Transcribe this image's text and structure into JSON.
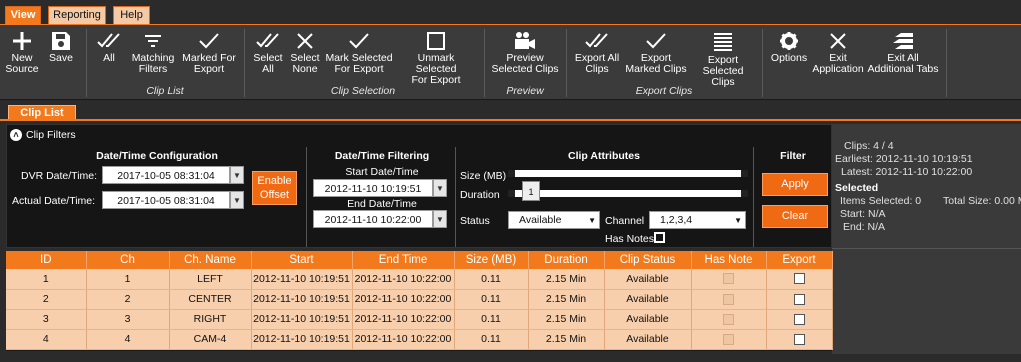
{
  "menu": {
    "tabs": [
      "View",
      "Reporting",
      "Help"
    ]
  },
  "ribbon": {
    "buttons": [
      {
        "l1": "New",
        "l2": "Source",
        "icon": "plus-icon"
      },
      {
        "l1": "Save",
        "l2": "",
        "icon": "save-icon"
      },
      {
        "l1": "All",
        "l2": "",
        "icon": "double-check-icon"
      },
      {
        "l1": "Matching",
        "l2": "Filters",
        "icon": "filter-lines-icon"
      },
      {
        "l1": "Marked For",
        "l2": "Export",
        "icon": "check-icon"
      },
      {
        "l1": "Select",
        "l2": "All",
        "icon": "double-check-icon"
      },
      {
        "l1": "Select",
        "l2": "None",
        "icon": "x-icon"
      },
      {
        "l1": "Mark Selected",
        "l2": "For Export",
        "icon": "check-icon"
      },
      {
        "l1": "Unmark Selected",
        "l2": "For Export",
        "icon": "empty-square-icon"
      },
      {
        "l1": "Preview",
        "l2": "Selected Clips",
        "icon": "video-camera-icon"
      },
      {
        "l1": "Export All",
        "l2": "Clips",
        "icon": "double-check-icon"
      },
      {
        "l1": "Export",
        "l2": "Marked Clips",
        "icon": "check-icon"
      },
      {
        "l1": "Export",
        "l2": "Selected Clips",
        "icon": "list-lines-icon"
      },
      {
        "l1": "Options",
        "l2": "",
        "icon": "gear-icon"
      },
      {
        "l1": "Exit",
        "l2": "Application",
        "icon": "x-icon"
      },
      {
        "l1": "Exit All",
        "l2": "Additional Tabs",
        "icon": "stacked-arrow-icon"
      }
    ],
    "groups": [
      "Clip List",
      "Clip Selection",
      "Preview",
      "Export Clips"
    ]
  },
  "tab": {
    "label": "Clip List"
  },
  "filters": {
    "title": "Clip Filters",
    "dt_config": {
      "heading": "Date/Time Configuration",
      "dvr_label": "DVR Date/Time:",
      "dvr_value": "2017-10-05 08:31:04",
      "actual_label": "Actual Date/Time:",
      "actual_value": "2017-10-05 08:31:04",
      "offset_button": "Enable Offset"
    },
    "dt_filter": {
      "heading": "Date/Time Filtering",
      "start_label": "Start Date/Time",
      "start_value": "2012-11-10 10:19:51",
      "end_label": "End Date/Time",
      "end_value": "2012-11-10 10:22:00"
    },
    "attributes": {
      "heading": "Clip Attributes",
      "size_label": "Size (MB)",
      "duration_label": "Duration",
      "duration_value": "1",
      "status_label": "Status",
      "status_value": "Available",
      "channel_label": "Channel",
      "channel_value": "1,2,3,4",
      "hasnotes_label": "Has Notes"
    },
    "filter": {
      "heading": "Filter",
      "apply": "Apply",
      "clear": "Clear"
    }
  },
  "stats": {
    "clips": "Clips:  4 / 4",
    "earliest": "Earliest:  2012-11-10 10:19:51",
    "latest": "Latest:  2012-11-10 10:22:00",
    "selected_heading": "Selected",
    "items_selected": "Items Selected: 0",
    "total_size": "Total Size: 0.00 M",
    "start": "Start:  N/A",
    "end": "End:  N/A"
  },
  "table": {
    "headers": [
      "ID",
      "Ch",
      "Ch. Name",
      "Start",
      "End Time",
      "Size (MB)",
      "Duration",
      "Clip Status",
      "Has Note",
      "Export"
    ],
    "rows": [
      [
        "1",
        "1",
        "LEFT",
        "2012-11-10 10:19:51",
        "2012-11-10 10:22:00",
        "0.11",
        "2.15 Min",
        "Available"
      ],
      [
        "2",
        "2",
        "CENTER",
        "2012-11-10 10:19:51",
        "2012-11-10 10:22:00",
        "0.11",
        "2.15 Min",
        "Available"
      ],
      [
        "3",
        "3",
        "RIGHT",
        "2012-11-10 10:19:51",
        "2012-11-10 10:22:00",
        "0.11",
        "2.15 Min",
        "Available"
      ],
      [
        "4",
        "4",
        "CAM-4",
        "2012-11-10 10:19:51",
        "2012-11-10 10:22:00",
        "0.11",
        "2.15 Min",
        "Available"
      ]
    ]
  },
  "colors": {
    "accent": "#f27a1d",
    "row": "#f8cfac",
    "panel": "#151515"
  }
}
